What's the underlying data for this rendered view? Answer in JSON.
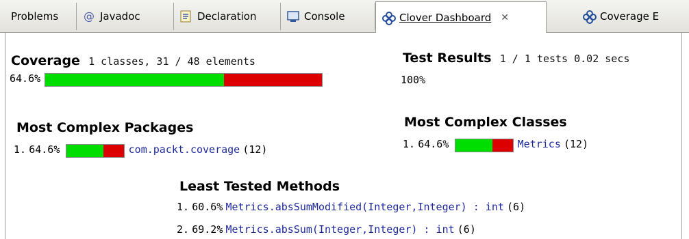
{
  "tabs": [
    {
      "label": "Problems",
      "icon": "none"
    },
    {
      "label": "Javadoc",
      "icon": "at-icon"
    },
    {
      "label": "Declaration",
      "icon": "declaration-icon"
    },
    {
      "label": "Console",
      "icon": "console-icon"
    },
    {
      "label": "Clover Dashboard",
      "icon": "clover-icon",
      "active": true,
      "close": "✕"
    },
    {
      "label": "Coverage E",
      "icon": "clover-icon"
    }
  ],
  "coverage": {
    "title": "Coverage",
    "summary": "1 classes, 31 / 48 elements",
    "percent_label": "64.6%",
    "percent": 64.6
  },
  "test_results": {
    "title": "Test Results",
    "summary": "1 / 1 tests 0.02 secs",
    "percent_label": "100%"
  },
  "complex_packages": {
    "title": "Most Complex Packages",
    "items": [
      {
        "rank": "1.",
        "percent_label": "64.6%",
        "percent": 64.6,
        "name": "com.packt.coverage",
        "count": "(12)"
      }
    ]
  },
  "complex_classes": {
    "title": "Most Complex Classes",
    "items": [
      {
        "rank": "1.",
        "percent_label": "64.6%",
        "percent": 64.6,
        "name": "Metrics",
        "count": "(12)"
      }
    ]
  },
  "least_tested": {
    "title": "Least Tested Methods",
    "items": [
      {
        "rank": "1.",
        "percent_label": "60.6%",
        "name": "Metrics.absSumModified(Integer,Integer) : int",
        "count": "(6)"
      },
      {
        "rank": "2.",
        "percent_label": "69.2%",
        "name": "Metrics.absSum(Integer,Integer) : int",
        "count": "(6)"
      }
    ]
  },
  "colors": {
    "covered": "#00dd00",
    "uncovered": "#dd0000",
    "link": "#1e2a9e"
  }
}
